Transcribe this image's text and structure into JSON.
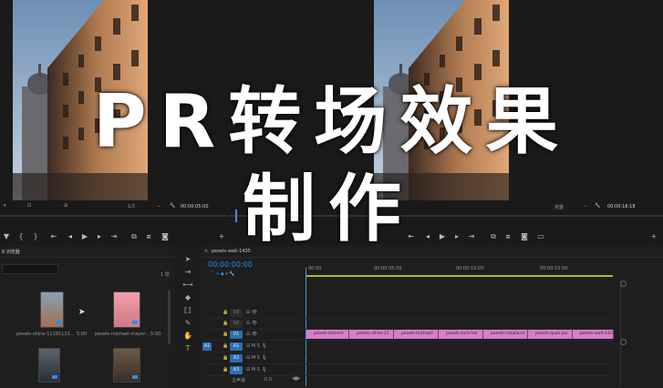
{
  "overlay": {
    "line1": "PR转场效果",
    "line2": "制作"
  },
  "source_monitor": {
    "fraction": "1/3",
    "timecode": "00:00:05:00"
  },
  "program_monitor": {
    "quality": "完整",
    "timecode": "00:00:18:18"
  },
  "project_panel": {
    "title": "8 浏览器",
    "count": "1 项",
    "items": [
      {
        "name": "pexels-olline-11281133...",
        "duration": "5:00"
      },
      {
        "name": "pexels-michael-mayor-...",
        "duration": "5:00"
      }
    ]
  },
  "timeline": {
    "tab": "pexels-walt-1435",
    "timecode": "00:00:00:00",
    "ruler": [
      "00:00",
      "00:00:05:00",
      "00:00:10:00",
      "00:00:15:00"
    ],
    "tracks": [
      {
        "label": "V3"
      },
      {
        "label": "V2"
      },
      {
        "label": "V1"
      },
      {
        "label": "A1"
      },
      {
        "label": "A2"
      },
      {
        "label": "A3"
      }
    ],
    "master": "主声道",
    "master_value": "0.0",
    "clips": [
      {
        "label": "pexels-ahmed-"
      },
      {
        "label": "pexels-olline-11"
      },
      {
        "label": "pexels-michael-"
      },
      {
        "label": "pexels-zura-har"
      },
      {
        "label": "pexels-natalia-m"
      },
      {
        "label": "pexels-quan-jus"
      },
      {
        "label": "pexels-walt-142"
      }
    ]
  },
  "colors": {
    "accent": "#2d8ceb",
    "clip": "#d77ecb",
    "playhead": "#4a90e2"
  },
  "icons": [
    "play-icon",
    "step-back-icon",
    "step-forward-icon",
    "camera-icon",
    "wrench-icon",
    "add-icon",
    "arrow-tool-icon",
    "razor-tool-icon",
    "hand-tool-icon",
    "text-tool-icon",
    "pen-tool-icon",
    "eye-icon",
    "lock-icon"
  ]
}
